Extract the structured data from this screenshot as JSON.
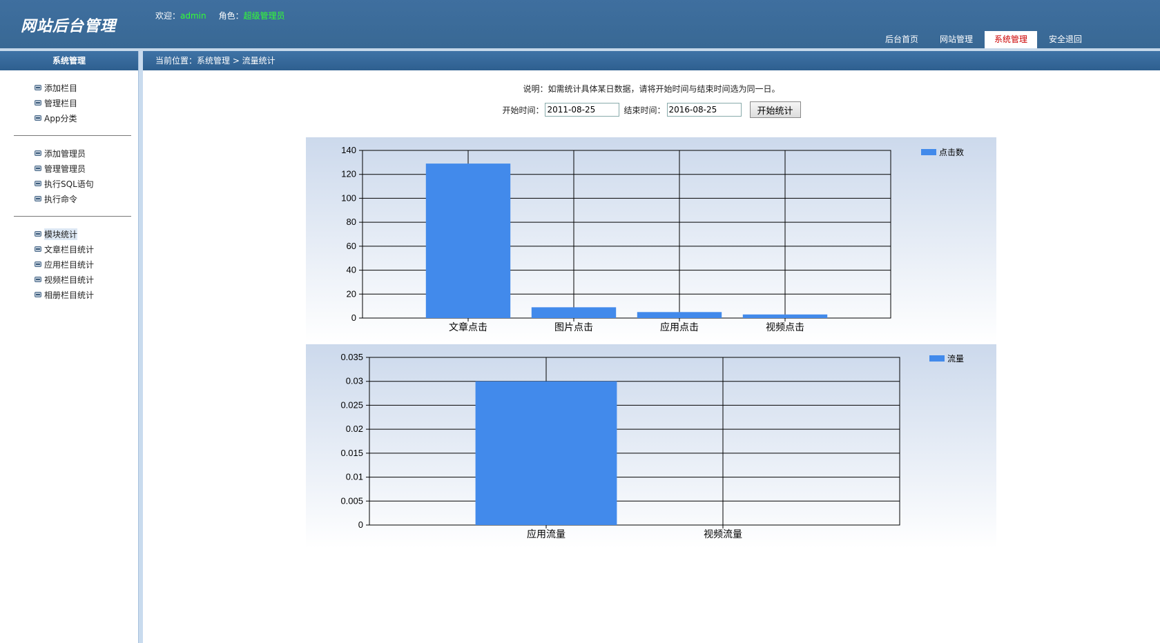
{
  "header": {
    "logo": "网站后台管理",
    "welcome_label": "欢迎：",
    "username": "admin",
    "role_label": "角色：",
    "role": "超级管理员",
    "nav": [
      "后台首页",
      "网站管理",
      "系统管理",
      "安全退回"
    ],
    "active_nav": "系统管理"
  },
  "sidebar": {
    "title": "系统管理",
    "groups": [
      [
        "添加栏目",
        "管理栏目",
        "App分类"
      ],
      [
        "添加管理员",
        "管理管理员",
        "执行SQL语句",
        "执行命令"
      ],
      [
        "模块统计",
        "文章栏目统计",
        "应用栏目统计",
        "视频栏目统计",
        "相册栏目统计"
      ]
    ],
    "active_item": "模块统计"
  },
  "breadcrumb": "当前位置：系统管理 > 流量统计",
  "note": "说明：如需统计具体某日数据，请将开始时间与结束时间选为同一日。",
  "filter": {
    "start_label": "开始时间：",
    "start_value": "2011-08-25",
    "end_label": "结束时间：",
    "end_value": "2016-08-25",
    "submit_label": "开始统计"
  },
  "colors": {
    "bar": "#428aeb",
    "header": "#386894",
    "active_nav_text": "#cc0000",
    "highlight": "#33ff33"
  },
  "chart_data": [
    {
      "type": "bar",
      "categories": [
        "文章点击",
        "图片点击",
        "应用点击",
        "视频点击"
      ],
      "series": [
        {
          "name": "点击数",
          "values": [
            129,
            9,
            5,
            3
          ]
        }
      ],
      "ylim": [
        0,
        140
      ],
      "yticks": [
        0,
        20,
        40,
        60,
        80,
        100,
        120,
        140
      ],
      "ytick_labels": [
        "0",
        "20",
        "40",
        "60",
        "80",
        "100",
        "120",
        "140"
      ],
      "title": "",
      "xlabel": "",
      "ylabel": "",
      "grid": true,
      "legend": "top-right"
    },
    {
      "type": "bar",
      "categories": [
        "应用流量",
        "视频流量"
      ],
      "series": [
        {
          "name": "流量",
          "values": [
            0.03,
            0
          ]
        }
      ],
      "ylim": [
        0,
        0.035
      ],
      "yticks": [
        0,
        0.005,
        0.01,
        0.015,
        0.02,
        0.025,
        0.03,
        0.035
      ],
      "ytick_labels": [
        "0",
        "0.005",
        "0.01",
        "0.015",
        "0.02",
        "0.025",
        "0.03",
        "0.035"
      ],
      "title": "",
      "xlabel": "",
      "ylabel": "",
      "grid": true,
      "legend": "top-right"
    }
  ]
}
